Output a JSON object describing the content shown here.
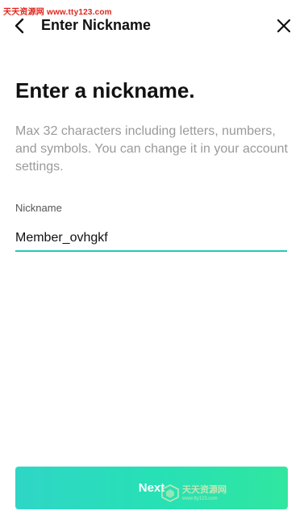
{
  "watermark": {
    "top_text": "天天资源网 www.tty123.com",
    "logo_cn": "天天资源网",
    "logo_url": "www.tty123.com"
  },
  "header": {
    "title": "Enter Nickname",
    "back_icon": "chevron-left-icon",
    "close_icon": "close-icon"
  },
  "main": {
    "heading": "Enter a nickname.",
    "helper_text": "Max 32 characters including letters, numbers, and symbols. You can change it in your account settings."
  },
  "nickname_field": {
    "label": "Nickname",
    "value": "Member_ovhgkf"
  },
  "footer": {
    "next_label": "Next"
  },
  "colors": {
    "accent": "#22c9b0",
    "button_start": "#2fd6c6",
    "button_end": "#30e6a0",
    "heading": "#111111",
    "helper": "#9a9a9a",
    "watermark_red": "#e0261c"
  }
}
